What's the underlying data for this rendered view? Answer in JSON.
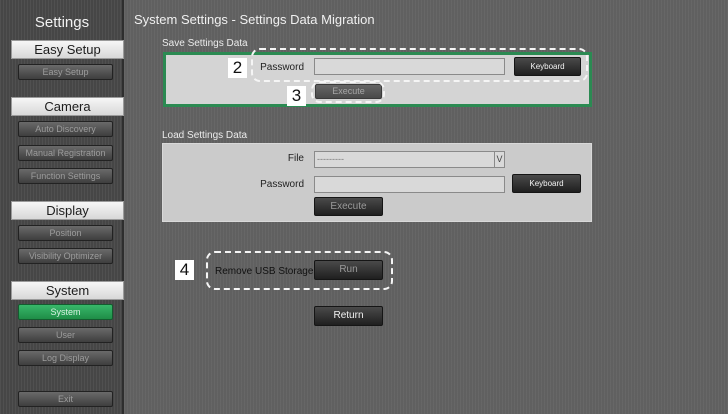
{
  "sidebar": {
    "title": "Settings",
    "sections": [
      {
        "header": "Easy Setup",
        "items": [
          {
            "label": "Easy Setup",
            "active": false
          }
        ]
      },
      {
        "header": "Camera",
        "items": [
          {
            "label": "Auto Discovery",
            "active": false
          },
          {
            "label": "Manual Registration",
            "active": false
          },
          {
            "label": "Function Settings",
            "active": false
          }
        ]
      },
      {
        "header": "Display",
        "items": [
          {
            "label": "Position",
            "active": false
          },
          {
            "label": "Visibility Optimizer",
            "active": false
          }
        ]
      },
      {
        "header": "System",
        "items": [
          {
            "label": "System",
            "active": true
          },
          {
            "label": "User",
            "active": false
          },
          {
            "label": "Log Display",
            "active": false
          }
        ]
      }
    ],
    "exit_label": "Exit"
  },
  "main": {
    "title": "System Settings - Settings Data Migration",
    "save": {
      "section_label": "Save Settings Data",
      "password_label": "Password",
      "password_value": "",
      "keyboard_label": "Keyboard",
      "execute_label": "Execute"
    },
    "load": {
      "section_label": "Load Settings Data",
      "file_label": "File",
      "file_value": "---------",
      "select_arrow": "V",
      "password_label": "Password",
      "password_value": "",
      "keyboard_label": "Keyboard",
      "execute_label": "Execute"
    },
    "remove_usb": {
      "label": "Remove USB Storage",
      "run_label": "Run"
    },
    "return_label": "Return"
  },
  "callouts": {
    "c2": "2",
    "c3": "3",
    "c4": "4"
  },
  "colors": {
    "active_green": "#2b9e58",
    "highlight_border": "#2b8a52",
    "sidebar_bg": "#494949",
    "main_bg": "#636363"
  }
}
